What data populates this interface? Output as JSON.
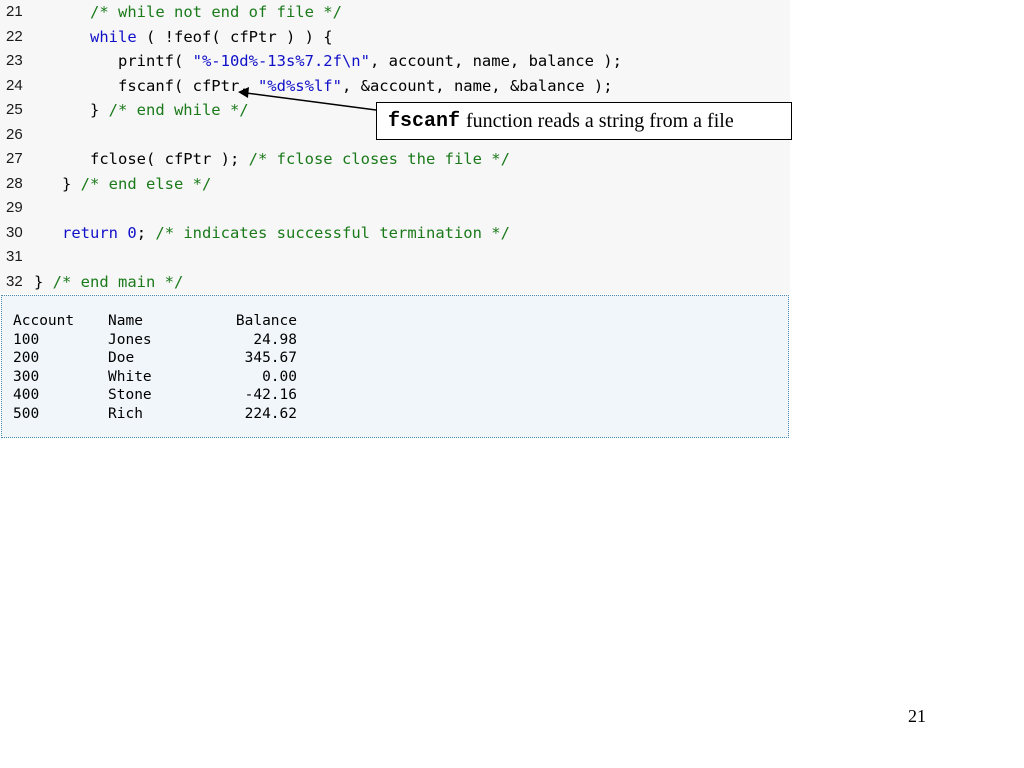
{
  "code_lines": [
    {
      "num": "21",
      "tokens": [
        {
          "t": "      ",
          "k": "plain"
        },
        {
          "t": "/* while not end of file */",
          "k": "cm"
        }
      ]
    },
    {
      "num": "22",
      "tokens": [
        {
          "t": "      ",
          "k": "plain"
        },
        {
          "t": "while",
          "k": "kw"
        },
        {
          "t": " ( !feof( cfPtr ) ) {",
          "k": "plain"
        }
      ]
    },
    {
      "num": "23",
      "tokens": [
        {
          "t": "         printf( ",
          "k": "plain"
        },
        {
          "t": "\"%-10d%-13s%7.2f\\n\"",
          "k": "str"
        },
        {
          "t": ", account, name, balance );",
          "k": "plain"
        }
      ]
    },
    {
      "num": "24",
      "tokens": [
        {
          "t": "         fscanf( cfPtr, ",
          "k": "plain"
        },
        {
          "t": "\"%d%s%lf\"",
          "k": "str"
        },
        {
          "t": ", &account, name, &balance );",
          "k": "plain"
        }
      ]
    },
    {
      "num": "25",
      "tokens": [
        {
          "t": "      } ",
          "k": "plain"
        },
        {
          "t": "/* end while */",
          "k": "cm"
        }
      ]
    },
    {
      "num": "26",
      "tokens": []
    },
    {
      "num": "27",
      "tokens": [
        {
          "t": "      fclose( cfPtr ); ",
          "k": "plain"
        },
        {
          "t": "/* fclose closes the file */",
          "k": "cm"
        }
      ]
    },
    {
      "num": "28",
      "tokens": [
        {
          "t": "   } ",
          "k": "plain"
        },
        {
          "t": "/* end else */",
          "k": "cm"
        }
      ]
    },
    {
      "num": "29",
      "tokens": []
    },
    {
      "num": "30",
      "tokens": [
        {
          "t": "   ",
          "k": "plain"
        },
        {
          "t": "return",
          "k": "kw"
        },
        {
          "t": " ",
          "k": "plain"
        },
        {
          "t": "0",
          "k": "num"
        },
        {
          "t": "; ",
          "k": "plain"
        },
        {
          "t": "/* indicates successful termination */",
          "k": "cm"
        }
      ]
    },
    {
      "num": "31",
      "tokens": []
    },
    {
      "num": "32",
      "tokens": [
        {
          "t": "} ",
          "k": "plain"
        },
        {
          "t": "/* end main */",
          "k": "cm"
        }
      ]
    }
  ],
  "output": {
    "headers": [
      "Account",
      "Name",
      "Balance"
    ],
    "rows": [
      [
        "100",
        "Jones",
        "24.98"
      ],
      [
        "200",
        "Doe",
        "345.67"
      ],
      [
        "300",
        "White",
        "0.00"
      ],
      [
        "400",
        "Stone",
        "-42.16"
      ],
      [
        "500",
        "Rich",
        "224.62"
      ]
    ]
  },
  "callout": {
    "code_word": "fscanf",
    "text": "function reads a string from a file"
  },
  "page_number": "21"
}
